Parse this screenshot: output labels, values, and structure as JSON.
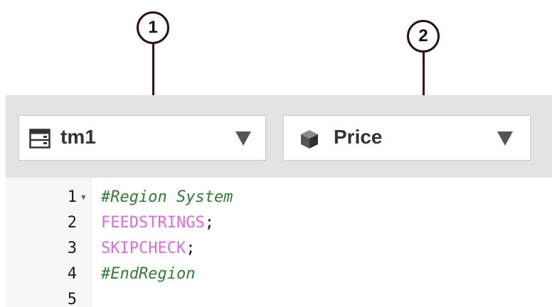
{
  "callouts": [
    {
      "number": "1"
    },
    {
      "number": "2"
    }
  ],
  "toolbar": {
    "server_dropdown": {
      "label": "tm1",
      "icon": "server-icon"
    },
    "cube_dropdown": {
      "label": "Price",
      "icon": "cube-icon"
    }
  },
  "editor": {
    "lines": [
      {
        "number": "1",
        "foldable": true,
        "text": "#Region System",
        "kind": "comment"
      },
      {
        "number": "2",
        "foldable": false,
        "keyword": "FEEDSTRINGS",
        "punct": ";",
        "kind": "statement"
      },
      {
        "number": "3",
        "foldable": false,
        "keyword": "SKIPCHECK",
        "punct": ";",
        "kind": "statement"
      },
      {
        "number": "4",
        "foldable": false,
        "text": "#EndRegion",
        "kind": "comment"
      },
      {
        "number": "5",
        "foldable": false,
        "text": "",
        "kind": "empty"
      }
    ],
    "colors": {
      "comment": "#2e7d32",
      "keyword": "#e069e0"
    }
  }
}
